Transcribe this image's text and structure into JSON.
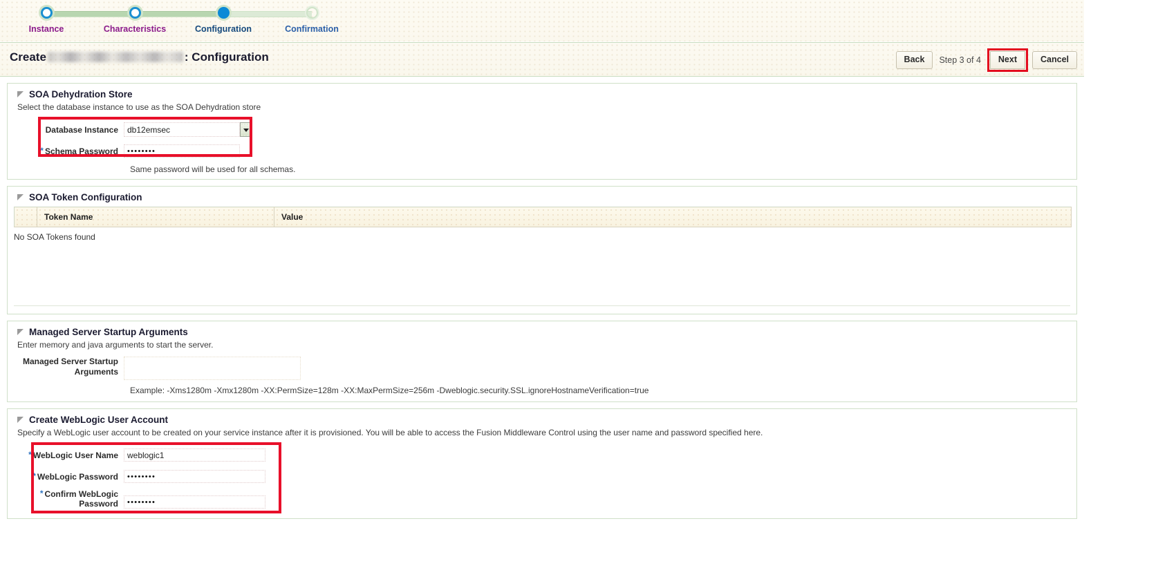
{
  "train": {
    "steps": [
      {
        "label": "Instance",
        "state": "done"
      },
      {
        "label": "Characteristics",
        "state": "done"
      },
      {
        "label": "Configuration",
        "state": "active"
      },
      {
        "label": "Confirmation",
        "state": "future"
      }
    ]
  },
  "header": {
    "title_prefix": "Create",
    "instance_name_redacted": "",
    "title_suffix": ": Configuration",
    "back_label": "Back",
    "step_counter": "Step 3 of 4",
    "next_label": "Next",
    "cancel_label": "Cancel"
  },
  "dehydration": {
    "title": "SOA Dehydration Store",
    "description": "Select the database instance to use as the SOA Dehydration store",
    "database_instance_label": "Database Instance",
    "database_instance_value": "db12emsec",
    "schema_password_label": "Schema Password",
    "schema_password_value": "••••••••",
    "password_note": "Same password will be used for all schemas."
  },
  "token_config": {
    "title": "SOA Token Configuration",
    "columns": [
      "Token Name",
      "Value"
    ],
    "empty_text": "No SOA Tokens found",
    "rows": []
  },
  "startup_args": {
    "title": "Managed Server Startup Arguments",
    "description": "Enter memory and java arguments to start the server.",
    "field_label_line1": "Managed Server Startup",
    "field_label_line2": "Arguments",
    "field_value": "",
    "example": "Example: -Xms1280m -Xmx1280m -XX:PermSize=128m -XX:MaxPermSize=256m -Dweblogic.security.SSL.ignoreHostnameVerification=true"
  },
  "weblogic_account": {
    "title": "Create WebLogic User Account",
    "description": "Specify a WebLogic user account to be created on your service instance after it is provisioned. You will be able to access the Fusion Middleware Control using the user name and password specified here.",
    "user_name_label": "WebLogic User Name",
    "user_name_value": "weblogic1",
    "password_label": "WebLogic Password",
    "password_value": "••••••••",
    "confirm_label_line1": "Confirm WebLogic",
    "confirm_label_line2": "Password",
    "confirm_value": "••••••••"
  },
  "colors": {
    "annotation_red": "#e8102a",
    "active_step_blue": "#0b8ad6",
    "visited_step_purple": "#8b1a8b",
    "link_blue": "#2b5fa8"
  }
}
